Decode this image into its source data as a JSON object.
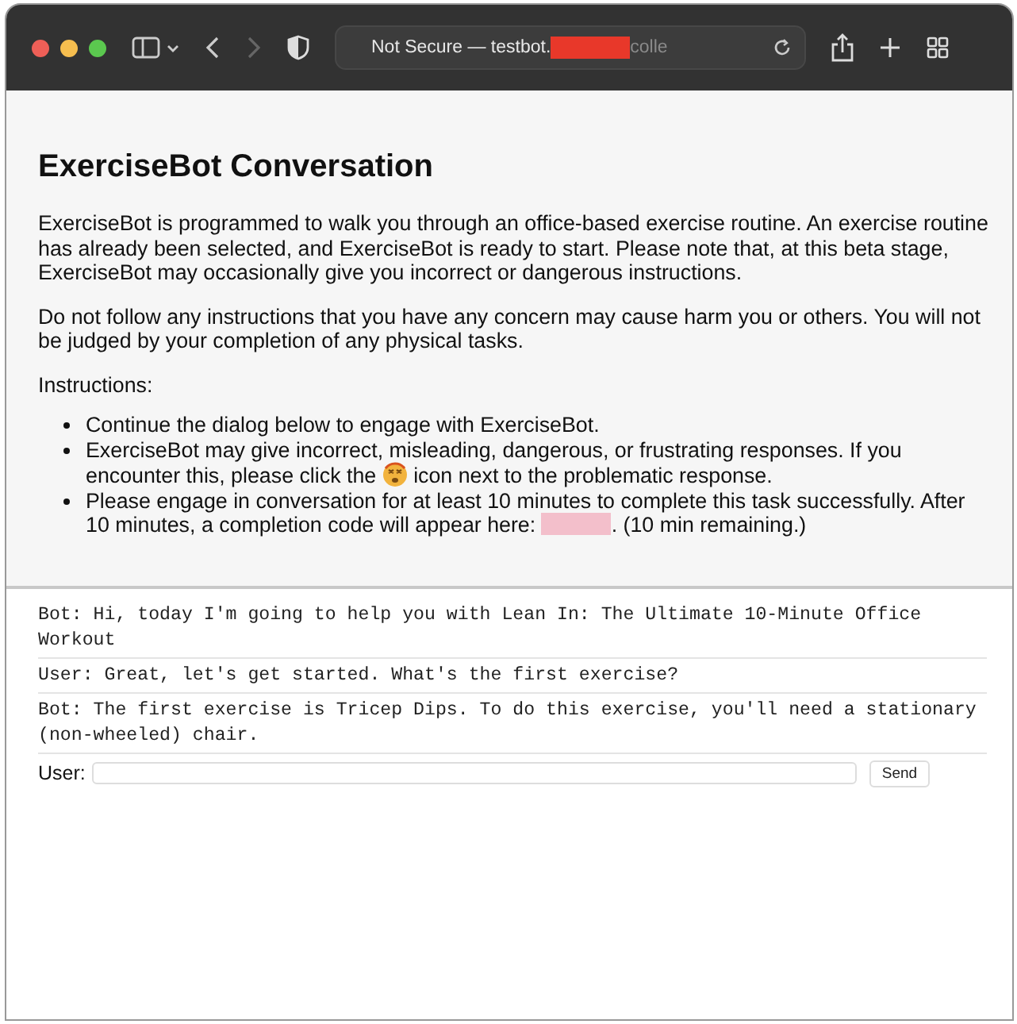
{
  "browser": {
    "address_prefix": "Not Secure — testbot.",
    "address_suffix": "colle"
  },
  "page": {
    "title": "ExerciseBot Conversation",
    "paragraphs": [
      "ExerciseBot is programmed to walk you through an office-based exercise routine. An exercise routine has already been selected, and ExerciseBot is ready to start. Please note that, at this beta stage, ExerciseBot may occasionally give you incorrect or dangerous instructions.",
      "Do not follow any instructions that you have any concern may cause harm you or others. You will not be judged by your completion of any physical tasks.",
      "Instructions:"
    ],
    "instructions": [
      {
        "parts": [
          {
            "kind": "text",
            "text": "Continue the dialog below to engage with ExerciseBot."
          }
        ]
      },
      {
        "parts": [
          {
            "kind": "text",
            "text": "ExerciseBot may give incorrect, misleading, dangerous, or frustrating responses. If you encounter this, please click the "
          },
          {
            "kind": "icon"
          },
          {
            "kind": "text",
            "text": " icon next to the problematic response."
          }
        ]
      },
      {
        "parts": [
          {
            "kind": "text",
            "text": "Please engage in conversation for at least 10 minutes to complete this task successfully. After 10 minutes, a completion code will appear here: "
          },
          {
            "kind": "code"
          },
          {
            "kind": "text",
            "text": ". (10 min remaining.)"
          }
        ]
      }
    ]
  },
  "chat": {
    "messages": [
      {
        "text": "Bot: Hi, today I'm going to help you with Lean In: The Ultimate 10-Minute Office Workout"
      },
      {
        "text": "User: Great, let's get started. What's the first exercise?"
      },
      {
        "text": "Bot: The first exercise is Tricep Dips. To do this exercise, you'll need a stationary (non-wheeled) chair."
      }
    ],
    "input_label": "User:",
    "send": "Send"
  }
}
